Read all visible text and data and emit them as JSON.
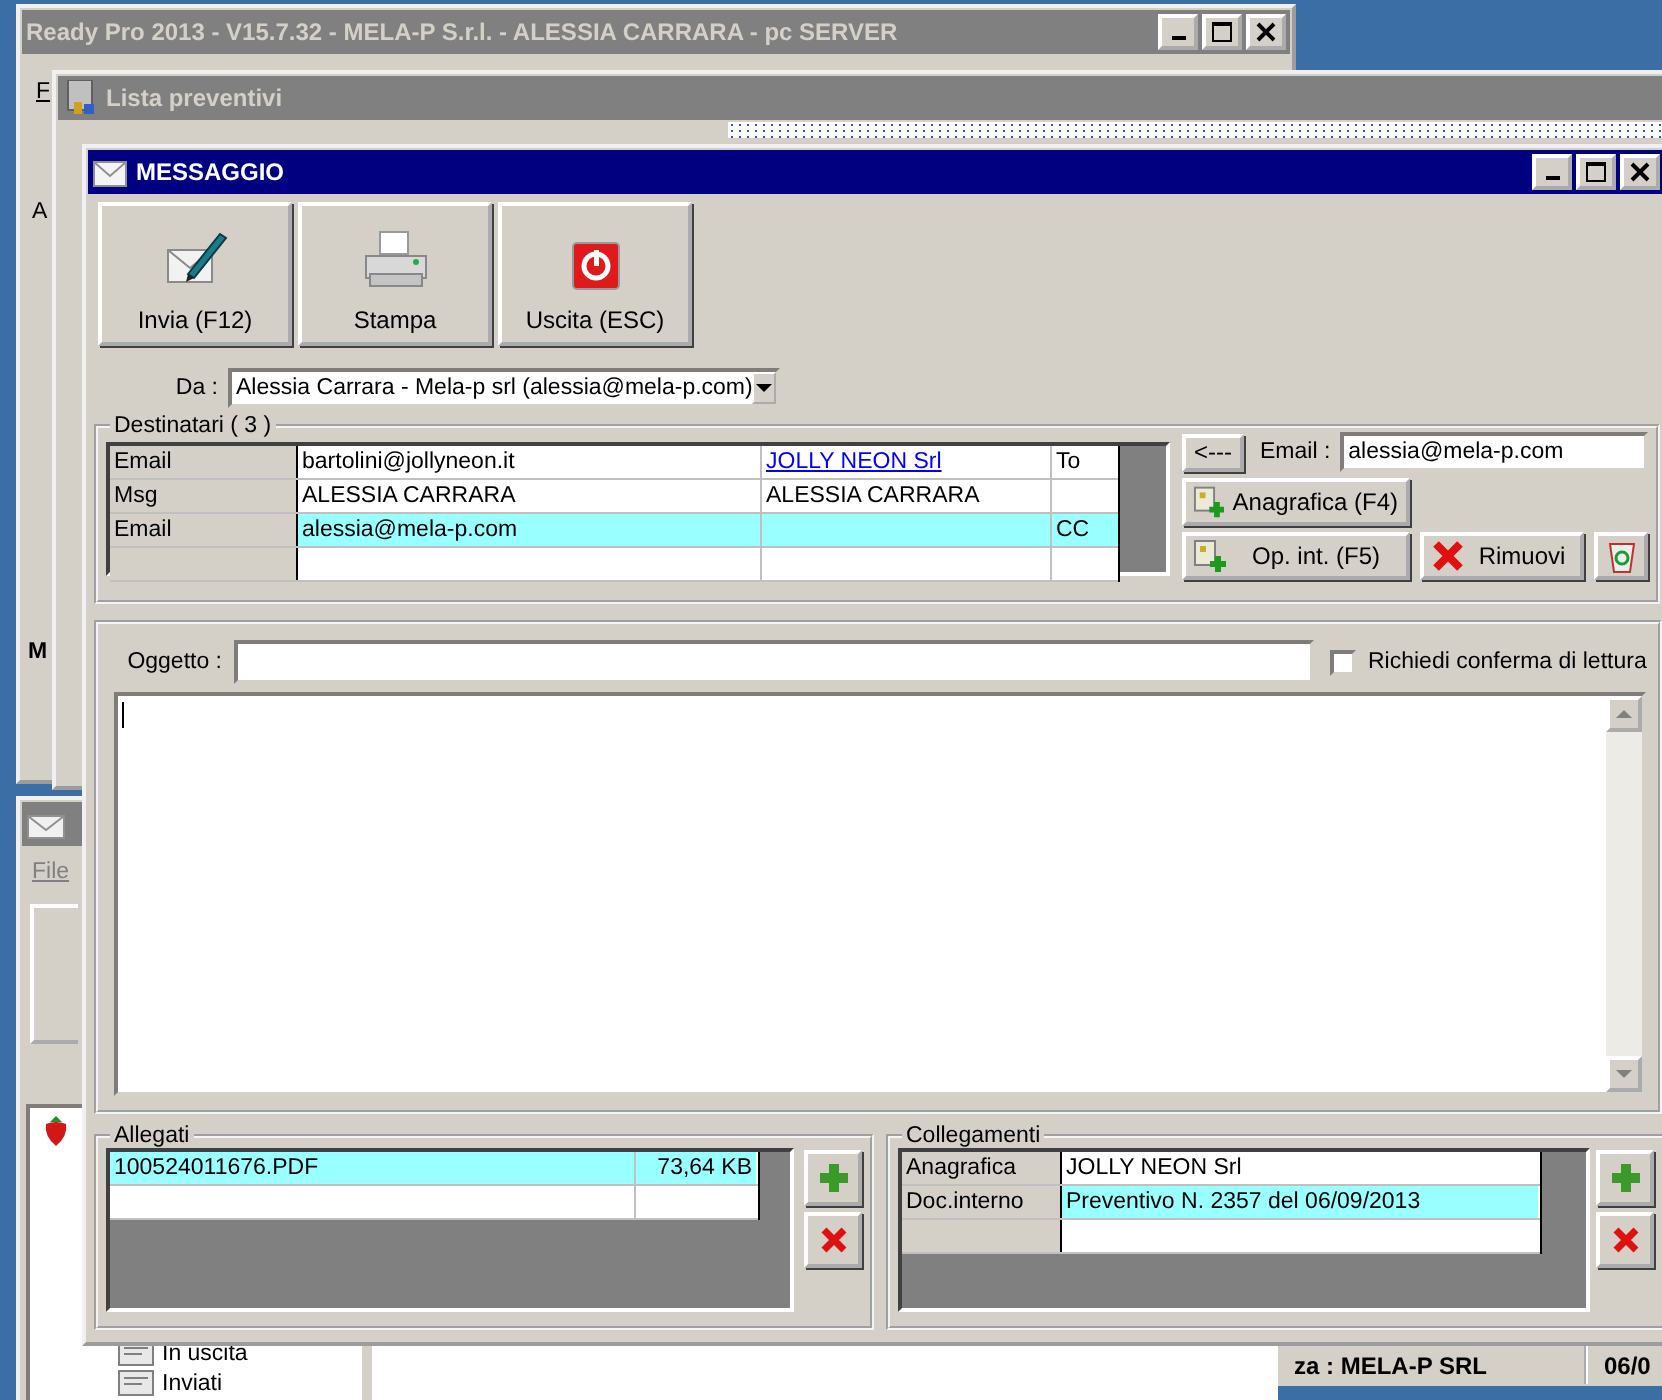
{
  "background_window": {
    "title": "Ready Pro 2013 - V15.7.32 - MELA-P S.r.l. - ALESSIA CARRARA - pc SERVER",
    "menu_letter": "F",
    "side_letters": [
      "A",
      "M"
    ]
  },
  "list_window": {
    "title": "Lista preventivi"
  },
  "mail_window": {
    "menu": "File",
    "tree": [
      {
        "label": "In uscita"
      },
      {
        "label": "Inviati"
      }
    ],
    "status": [
      "za : MELA-P SRL",
      "06/0"
    ]
  },
  "message_window": {
    "title": "MESSAGGIO",
    "toolbar": [
      {
        "label": "Invia (F12)",
        "kind": "send"
      },
      {
        "label": "Stampa",
        "kind": "print"
      },
      {
        "label": "Uscita (ESC)",
        "kind": "exit"
      }
    ],
    "from": {
      "label": "Da :",
      "value": "Alessia Carrara - Mela-p srl (alessia@mela-p.com)"
    },
    "recipients": {
      "title": "Destinatari ( 3 )",
      "rows": [
        {
          "type": "Email",
          "address": "bartolini@jollyneon.it",
          "name": "JOLLY NEON Srl",
          "name_link": true,
          "mode": "To",
          "selected": false
        },
        {
          "type": "Msg",
          "address": "ALESSIA CARRARA",
          "name": "ALESSIA CARRARA",
          "name_link": false,
          "selected": false
        },
        {
          "type": "Email",
          "address": "alessia@mela-p.com",
          "mode": "CC",
          "selected": true
        }
      ],
      "back_button": "<---",
      "email": {
        "label": "Email :",
        "value": "alessia@mela-p.com"
      },
      "buttons": [
        {
          "label": "Anagrafica (F4)",
          "kind": "add"
        },
        {
          "label": "Op. int. (F5)",
          "kind": "add"
        },
        {
          "label": "Rimuovi",
          "kind": "remove"
        }
      ]
    },
    "subject": {
      "label": "Oggetto :"
    },
    "read_receipt": {
      "label": "Richiedi conferma di lettura",
      "checked": false
    },
    "attachments": {
      "title": "Allegati",
      "rows": [
        {
          "file": "100524011676.PDF",
          "size": "73,64 KB",
          "selected": true
        }
      ]
    },
    "links": {
      "title": "Collegamenti",
      "rows": [
        {
          "type": "Anagrafica",
          "value": "JOLLY NEON Srl",
          "selected": false
        },
        {
          "type": "Doc.interno",
          "value": "Preventivo N. 2357 del 06/09/2013",
          "selected": true
        }
      ]
    }
  }
}
